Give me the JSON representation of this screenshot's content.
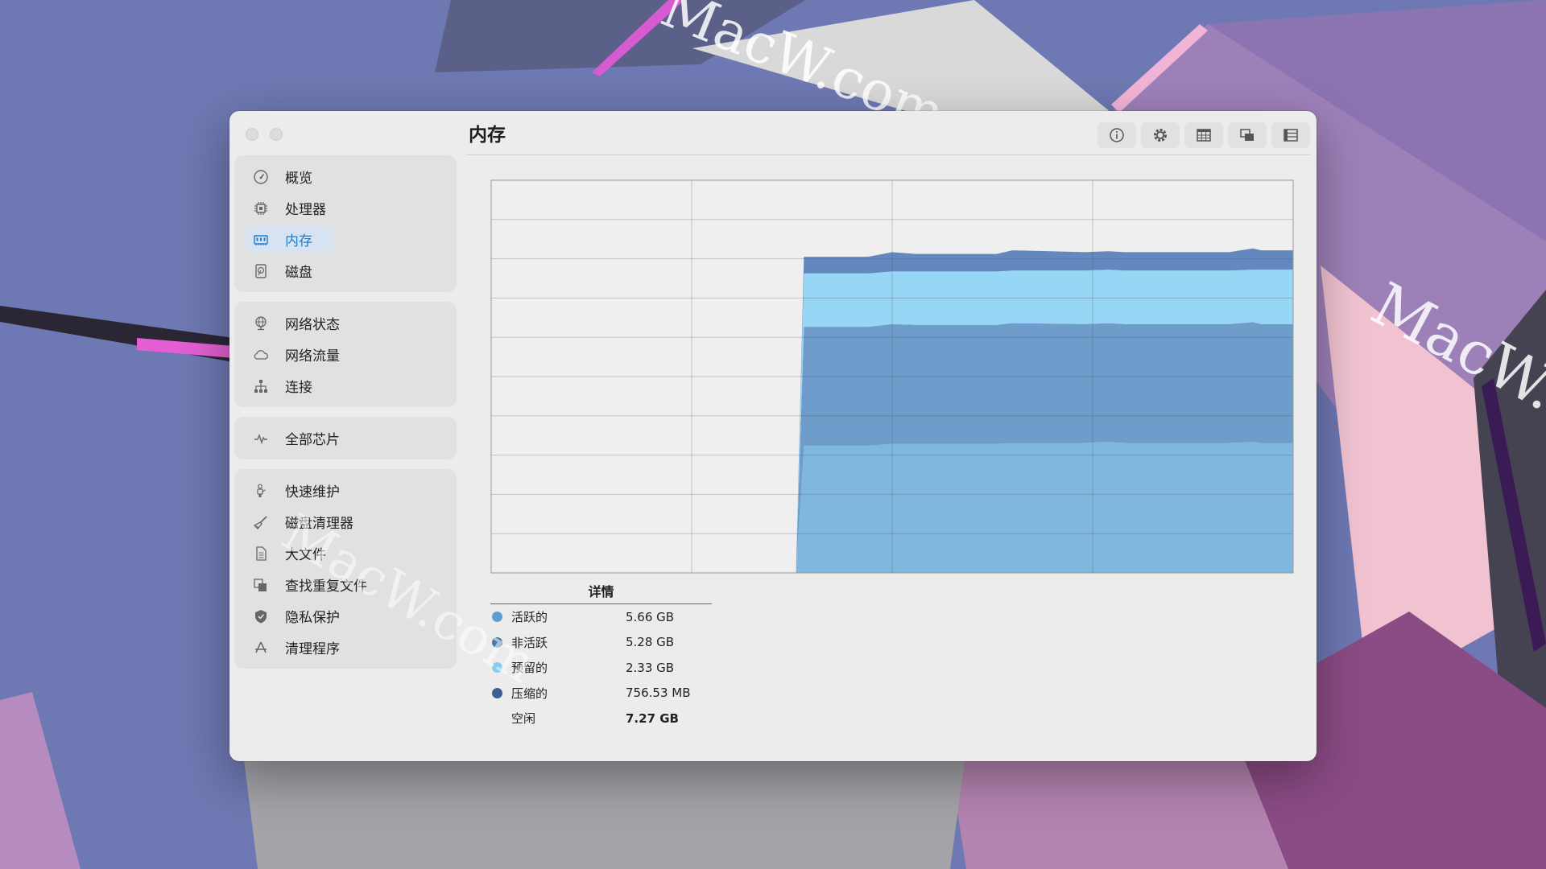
{
  "watermark": "MacW.com",
  "window": {
    "title": "内存"
  },
  "toolbar": {
    "buttons": [
      {
        "icon": "info-icon"
      },
      {
        "icon": "gear-icon"
      },
      {
        "icon": "grid-icon"
      },
      {
        "icon": "windows-icon"
      },
      {
        "icon": "list-icon"
      }
    ]
  },
  "sidebar": {
    "groups": [
      {
        "items": [
          {
            "label": "概览",
            "icon": "gauge-icon"
          },
          {
            "label": "处理器",
            "icon": "cpu-icon"
          },
          {
            "label": "内存",
            "icon": "memory-icon",
            "active": true
          },
          {
            "label": "磁盘",
            "icon": "disk-icon"
          }
        ]
      },
      {
        "items": [
          {
            "label": "网络状态",
            "icon": "globe-icon"
          },
          {
            "label": "网络流量",
            "icon": "cloud-icon"
          },
          {
            "label": "连接",
            "icon": "network-tree-icon"
          }
        ]
      },
      {
        "items": [
          {
            "label": "全部芯片",
            "icon": "pulse-icon"
          }
        ]
      },
      {
        "items": [
          {
            "label": "快速维护",
            "icon": "maintenance-icon"
          },
          {
            "label": "磁盘清理器",
            "icon": "broom-icon"
          },
          {
            "label": "大文件",
            "icon": "file-icon"
          },
          {
            "label": "查找重复文件",
            "icon": "duplicate-icon"
          },
          {
            "label": "隐私保护",
            "icon": "shield-icon"
          },
          {
            "label": "清理程序",
            "icon": "appstore-icon"
          }
        ]
      }
    ]
  },
  "details": {
    "header": "详情",
    "rows": [
      {
        "name": "活跃的",
        "value": "5.66 GB",
        "color": "#5d9fd3"
      },
      {
        "name": "非活跃",
        "value": "5.28 GB",
        "color": "#4b77ab"
      },
      {
        "name": "预留的",
        "value": "2.33 GB",
        "color": "#84cdee"
      },
      {
        "name": "压缩的",
        "value": "756.53 MB",
        "color": "#3c5f91"
      },
      {
        "name": "空闲",
        "value": "7.27 GB",
        "color": null
      }
    ]
  },
  "chart_data": {
    "type": "area",
    "stacked": true,
    "x": [
      0,
      38,
      39,
      47,
      50,
      53,
      63,
      65,
      74,
      77,
      79,
      92,
      95,
      96,
      100
    ],
    "xlim": [
      0,
      100
    ],
    "ylim": [
      0,
      21.3
    ],
    "grid": true,
    "series": [
      {
        "name": "活跃的",
        "color": "#7fb7de",
        "values": [
          0,
          0,
          6.9,
          6.9,
          7.0,
          7.0,
          7.0,
          7.05,
          7.05,
          7.1,
          7.05,
          7.05,
          7.1,
          7.05,
          7.05
        ]
      },
      {
        "name": "非活跃",
        "color": "#6e9ccb",
        "values": [
          0,
          0,
          6.45,
          6.45,
          6.5,
          6.45,
          6.45,
          6.5,
          6.45,
          6.45,
          6.45,
          6.45,
          6.5,
          6.45,
          6.45
        ]
      },
      {
        "name": "预留的",
        "color": "#97d6f4",
        "values": [
          0,
          0,
          2.9,
          2.9,
          2.85,
          2.9,
          2.9,
          2.85,
          2.9,
          2.9,
          2.9,
          2.9,
          2.85,
          2.95,
          2.95
        ]
      },
      {
        "name": "压缩的",
        "color": "#6288bd",
        "values": [
          0,
          0,
          0.9,
          0.9,
          1.05,
          0.95,
          0.95,
          1.1,
          1.0,
          1.0,
          1.0,
          1.0,
          1.15,
          1.05,
          1.05
        ]
      }
    ]
  }
}
